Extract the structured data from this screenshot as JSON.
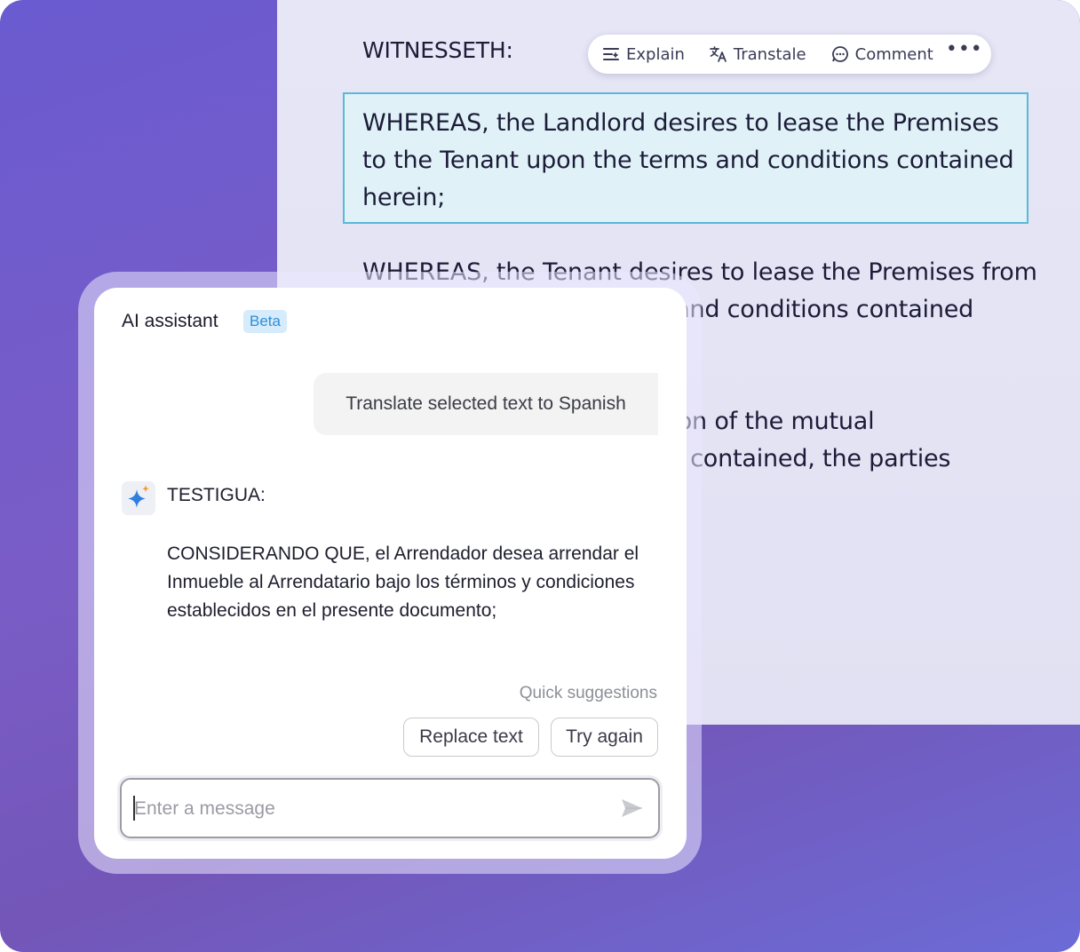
{
  "document": {
    "heading": "WITNESSETH:",
    "selected_paragraph": "WHEREAS, the Landlord desires to lease the Premises\nto the Tenant upon the terms and conditions contained\nherein;",
    "paragraph_2": "WHEREAS, the Tenant desires to lease the Premises from\n                                          and conditions contained",
    "paragraph_3": "                                   eration of the mutual\n                                   erein contained, the parties"
  },
  "toolbar": {
    "explain_label": "Explain",
    "translate_label": "Transtale",
    "comment_label": "Comment",
    "more_label": "•••",
    "icons": [
      "explain-icon",
      "translate-icon",
      "comment-icon",
      "more-icon"
    ]
  },
  "assistant": {
    "title": "AI assistant",
    "badge": "Beta",
    "user_message": "Translate selected text to Spanish",
    "response_heading": "TESTIGUA:",
    "response_body": "CONSIDERANDO QUE, el Arrendador desea arrendar el Inmueble al Arrendatario bajo los términos y condiciones establecidos en el presente documento;",
    "quick_suggestions_label": "Quick suggestions",
    "suggestions": [
      "Replace text",
      "Try again"
    ],
    "input_placeholder": "Enter a message",
    "input_value": ""
  },
  "colors": {
    "accent_blue": "#2e8fd6",
    "selection_border": "#5bb8d9",
    "selection_fill": "#e0f2f8",
    "background_purple": "#6a5bd0"
  }
}
